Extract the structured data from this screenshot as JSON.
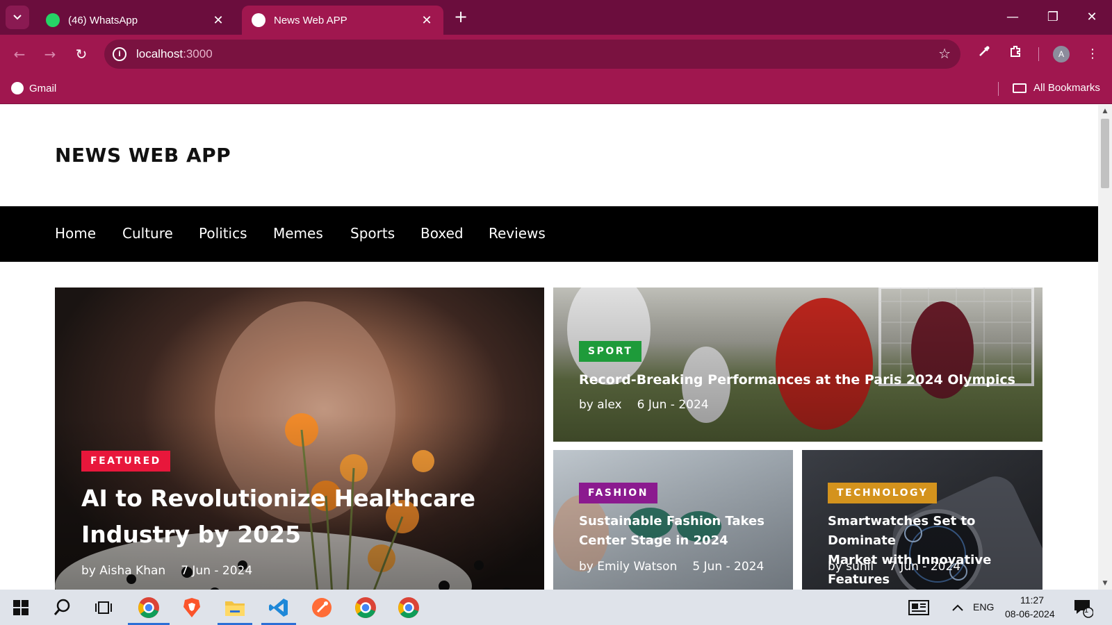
{
  "browser": {
    "tabs": [
      {
        "title": "(46) WhatsApp",
        "icon": "whatsapp-icon"
      },
      {
        "title": "News Web APP",
        "icon": "chrome-page-icon"
      }
    ],
    "url_host": "localhost",
    "url_port": ":3000",
    "bookmarks": {
      "left": "Gmail",
      "right": "All Bookmarks"
    },
    "profile_initial": "A",
    "colors": {
      "tabbar": "#6b0d3d",
      "toolbar": "#a0174f",
      "omnibox": "#7a1240"
    }
  },
  "site": {
    "title": "NEWS WEB APP",
    "nav": [
      "Home",
      "Culture",
      "Politics",
      "Memes",
      "Sports",
      "Boxed",
      "Reviews"
    ]
  },
  "articles": {
    "featured": {
      "category": "FEATURED",
      "category_color": "#e8173b",
      "title_line1": "AI to Revolutionize Healthcare",
      "title_line2": "Industry by 2025",
      "author": "by Aisha Khan",
      "date": "7 Jun - 2024"
    },
    "sport": {
      "category": "SPORT",
      "category_color": "#1e9b3a",
      "title": "Record-Breaking Performances at the Paris 2024 Olympics",
      "author": "by alex",
      "date": "6 Jun - 2024"
    },
    "fashion": {
      "category": "FASHION",
      "category_color": "#8b1a8f",
      "title_line1": "Sustainable Fashion Takes",
      "title_line2": "Center Stage in 2024",
      "author": "by Emily Watson",
      "date": "5 Jun - 2024"
    },
    "technology": {
      "category": "TECHNOLOGY",
      "category_color": "#d4931d",
      "title_line1": "Smartwatches Set to Dominate",
      "title_line2": "Market with Innovative Features",
      "author": "by sunil",
      "date": "7 Jun - 2024"
    }
  },
  "taskbar": {
    "language": "ENG",
    "time": "11:27",
    "date": "08-06-2024",
    "notification_count": "1"
  }
}
